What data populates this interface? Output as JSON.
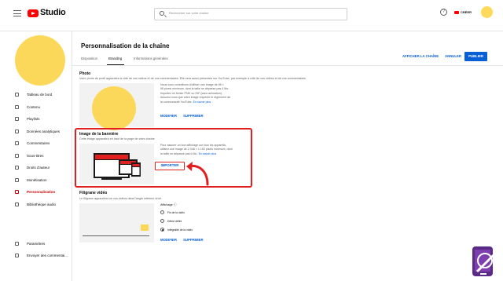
{
  "topbar": {
    "logo_text": "Studio",
    "search_placeholder": "Rechercher sur votre chaîne",
    "help_glyph": "?",
    "create_label": "CRÉER"
  },
  "sidebar": {
    "items": [
      {
        "label": "Tableau de bord",
        "icon": "dashboard-icon"
      },
      {
        "label": "Contenu",
        "icon": "content-icon"
      },
      {
        "label": "Playlists",
        "icon": "playlists-icon"
      },
      {
        "label": "Données analytiques",
        "icon": "analytics-icon"
      },
      {
        "label": "Commentaires",
        "icon": "comments-icon"
      },
      {
        "label": "Sous-titres",
        "icon": "subtitles-icon"
      },
      {
        "label": "Droits d'auteur",
        "icon": "copyright-icon"
      },
      {
        "label": "Monétisation",
        "icon": "monetization-icon"
      },
      {
        "label": "Personnalisation",
        "icon": "customization-icon",
        "active": true
      },
      {
        "label": "Bibliothèque audio",
        "icon": "audio-library-icon"
      }
    ],
    "bottom_items": [
      {
        "label": "Paramètres",
        "icon": "settings-icon"
      },
      {
        "label": "Envoyer des commentai...",
        "icon": "feedback-icon"
      }
    ]
  },
  "header": {
    "title": "Personnalisation de la chaîne",
    "tabs": [
      {
        "label": "Disposition"
      },
      {
        "label": "Branding",
        "active": true
      },
      {
        "label": "Informations générales"
      }
    ],
    "view_channel": "AFFICHER LA CHAÎNE",
    "cancel": "ANNULER",
    "publish": "PUBLIER"
  },
  "photo": {
    "title": "Photo",
    "desc": "Votre photo de profil apparaîtra à côté de vos vidéos et de vos commentaires. Elle sera aussi présentée sur YouTube, par exemple à côté de vos vidéos et de vos commentaires",
    "info_lines": [
      "Nous vous conseillons d'utiliser une image de 98 ×",
      "98 pixels minimum, dont la taille ne dépasse pas 4 Mo.",
      "Importez un fichier PNG ou GIF (sans animation).",
      "Assurez-vous que votre image respecte le règlement de",
      "la communauté YouTube."
    ],
    "info_link": "En savoir plus",
    "modify": "MODIFIER",
    "delete": "SUPPRIMER"
  },
  "banner": {
    "title": "Image de la bannière",
    "desc": "Cette image apparaîtra en haut de la page de votre chaîne",
    "info_lines": [
      "Pour assurer un bon affichage sur tous les appareils,",
      "utilisez une image de 2 048 × 1 152 pixels minimum, dont",
      "la taille ne dépasse pas 6 Mo."
    ],
    "info_link": "En savoir plus",
    "import": "IMPORTER"
  },
  "watermark": {
    "title": "Filigrane vidéo",
    "desc": "Le filigrane apparaîtra sur vos vidéos dans l'angle inférieur droit.",
    "display_label": "Affichage",
    "options": [
      {
        "label": "Fin de la vidéo",
        "selected": false
      },
      {
        "label": "Début défini",
        "selected": false
      },
      {
        "label": "Intégralité de la vidéo",
        "selected": true
      }
    ],
    "modify": "MODIFIER",
    "delete": "SUPPRIMER"
  },
  "colors": {
    "accent_red": "#ff0000",
    "link_blue": "#065fd4",
    "avatar_yellow": "#fcd85a",
    "highlight_red": "#e02020"
  }
}
